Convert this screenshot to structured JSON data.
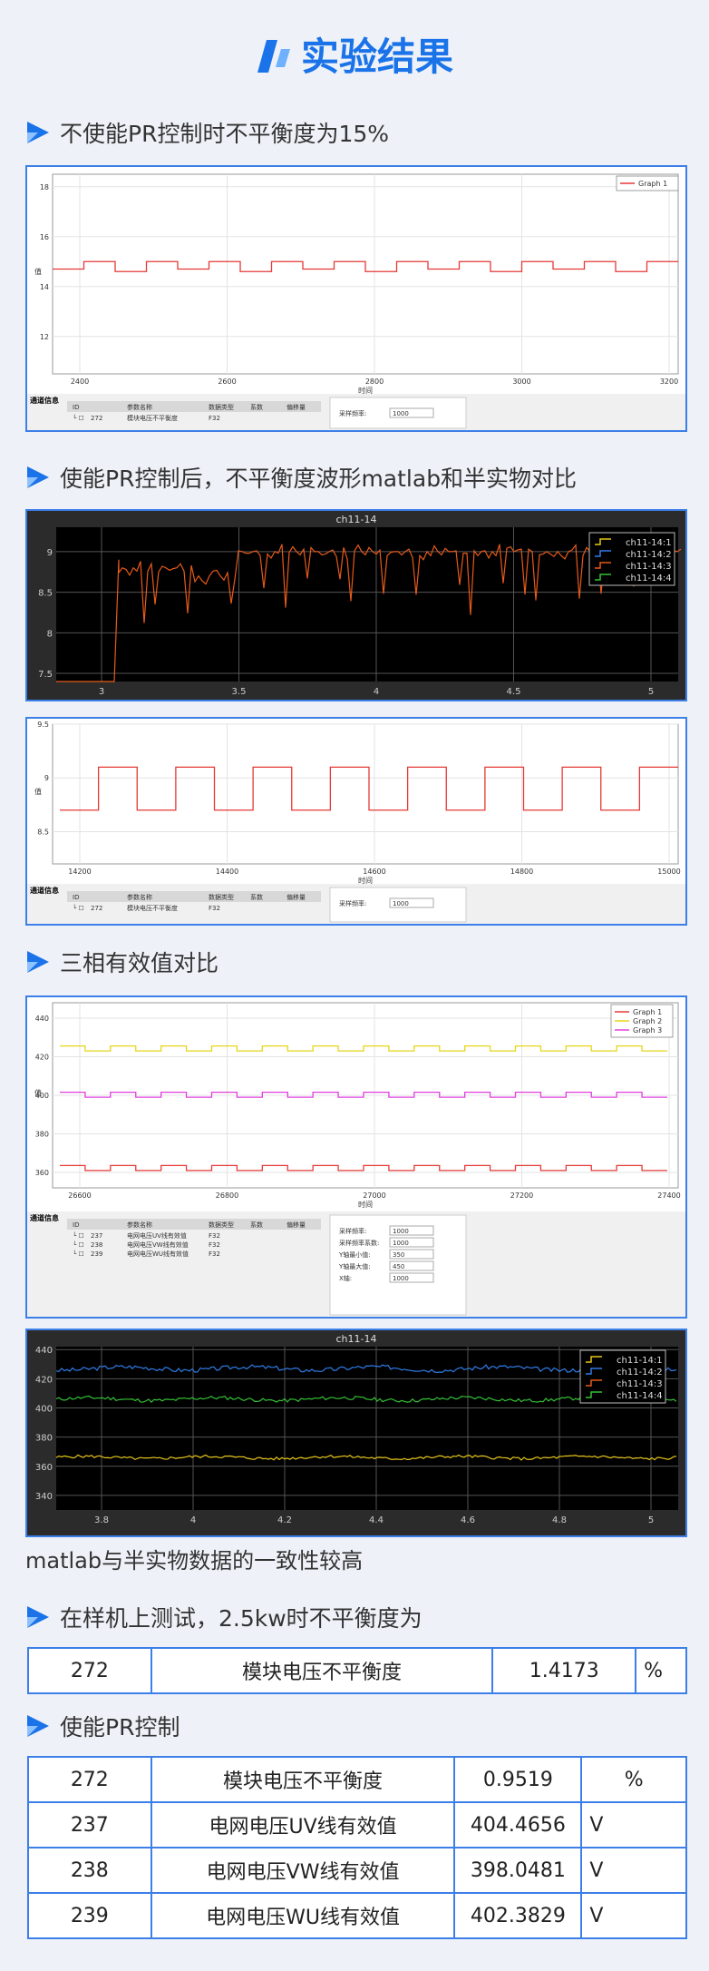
{
  "header": {
    "title": "实验结果"
  },
  "sections": {
    "s1": "不使能PR控制时不平衡度为15%",
    "s2": "使能PR控制后，不平衡度波形matlab和半实物对比",
    "s3": "三相有效值对比",
    "s4": "在样机上测试，2.5kw时不平衡度为",
    "s5": "使能PR控制"
  },
  "note": "matlab与半实物数据的一致性较高",
  "ui": {
    "time_label": "时间",
    "value_label": "值",
    "comm_info": "通道信息",
    "cols": [
      "ID",
      "参数名称",
      "数据类型",
      "系数",
      "偏移量"
    ],
    "sample_freq": "采样频率",
    "sample_freq_val": "1000",
    "sample_coef": "采样频率系数",
    "sample_coef_val": "1000",
    "ymin_label": "Y轴最小值",
    "ymin_val": "350",
    "ymax_label": "Y轴最大值",
    "ymax_val": "450",
    "x_label": "X轴",
    "x_val": "1000"
  },
  "rows1": [
    {
      "id": "272",
      "name": "模块电压不平衡度",
      "type": "F32"
    }
  ],
  "rows3": [
    {
      "id": "237",
      "name": "电网电压UV线有效值",
      "type": "F32"
    },
    {
      "id": "238",
      "name": "电网电压VW线有效值",
      "type": "F32"
    },
    {
      "id": "239",
      "name": "电网电压WU线有效值",
      "type": "F32"
    }
  ],
  "chart_data": [
    {
      "type": "line",
      "x_ticks": [
        "2400",
        "2600",
        "2800",
        "3000",
        "3200"
      ],
      "y_ticks": [
        "12",
        "14",
        "16",
        "18"
      ],
      "xlabel": "时间",
      "ylabel": "值",
      "ylim": [
        10.5,
        18.5
      ],
      "series": [
        {
          "name": "Graph 1",
          "color": "#e53935",
          "values": [
            14.7,
            15.0,
            14.6,
            15.0,
            14.7,
            15.0,
            14.6,
            15.0,
            14.7,
            15.0,
            14.6,
            15.0,
            14.7,
            15.0,
            14.6,
            15.0,
            14.7,
            15.0,
            14.6,
            15.0
          ]
        }
      ],
      "legend": "top-right"
    },
    {
      "type": "line",
      "title": "ch11-14",
      "x_ticks": [
        "3",
        "3.5",
        "4",
        "4.5",
        "5"
      ],
      "y_ticks": [
        "7.5",
        "8",
        "8.5",
        "9"
      ],
      "ylim": [
        7.4,
        9.3
      ],
      "series": [
        {
          "name": "ch11-14:1",
          "color": "#e6c619"
        },
        {
          "name": "ch11-14:2",
          "color": "#2f7de8"
        },
        {
          "name": "ch11-14:3",
          "color": "#e65a1a"
        },
        {
          "name": "ch11-14:4",
          "color": "#34c134"
        }
      ],
      "legend": "top-right"
    },
    {
      "type": "line",
      "x_ticks": [
        "14200",
        "14400",
        "14600",
        "14800",
        "15000"
      ],
      "y_ticks": [
        "8.5",
        "9",
        "9.5"
      ],
      "xlabel": "时间",
      "ylabel": "值",
      "ylim": [
        8.2,
        9.5
      ],
      "series": [
        {
          "name": "",
          "color": "#e53935",
          "values": [
            8.7,
            9.1,
            8.7,
            9.1,
            8.7,
            9.1,
            8.7,
            9.1,
            8.7,
            9.1,
            8.7,
            9.1,
            8.7,
            9.1,
            8.7,
            9.1
          ]
        }
      ]
    },
    {
      "type": "line",
      "x_ticks": [
        "26600",
        "26800",
        "27000",
        "27200",
        "27400"
      ],
      "y_ticks": [
        "360",
        "380",
        "400",
        "420",
        "440"
      ],
      "xlabel": "时间",
      "ylabel": "值",
      "ylim": [
        352,
        448
      ],
      "series": [
        {
          "name": "Graph 1",
          "color": "#e53935",
          "values": [
            363
          ]
        },
        {
          "name": "Graph 2",
          "color": "#e6d619",
          "values": [
            425
          ]
        },
        {
          "name": "Graph 3",
          "color": "#e040e0",
          "values": [
            401
          ]
        }
      ],
      "legend": "top-right"
    },
    {
      "type": "line",
      "title": "ch11-14",
      "x_ticks": [
        "3.8",
        "4",
        "4.2",
        "4.4",
        "4.6",
        "4.8",
        "5"
      ],
      "y_ticks": [
        "340",
        "360",
        "380",
        "400",
        "420",
        "440"
      ],
      "ylim": [
        330,
        442
      ],
      "series": [
        {
          "name": "ch11-14:1",
          "color": "#e6c619",
          "values": [
            366
          ]
        },
        {
          "name": "ch11-14:2",
          "color": "#2f7de8",
          "values": [
            427
          ]
        },
        {
          "name": "ch11-14:3",
          "color": "#e65a1a"
        },
        {
          "name": "ch11-14:4",
          "color": "#34c134",
          "values": [
            406
          ]
        }
      ],
      "legend": "top-right"
    }
  ],
  "table1": [
    {
      "id": "272",
      "name": "模块电压不平衡度",
      "value": "1.4173",
      "unit": "%"
    }
  ],
  "table2": [
    {
      "id": "272",
      "name": "模块电压不平衡度",
      "value": "0.9519",
      "unit": "%"
    },
    {
      "id": "237",
      "name": "电网电压UV线有效值",
      "value": "404.4656",
      "unit": "V"
    },
    {
      "id": "238",
      "name": "电网电压VW线有效值",
      "value": "398.0481",
      "unit": "V"
    },
    {
      "id": "239",
      "name": "电网电压WU线有效值",
      "value": "402.3829",
      "unit": "V"
    }
  ]
}
